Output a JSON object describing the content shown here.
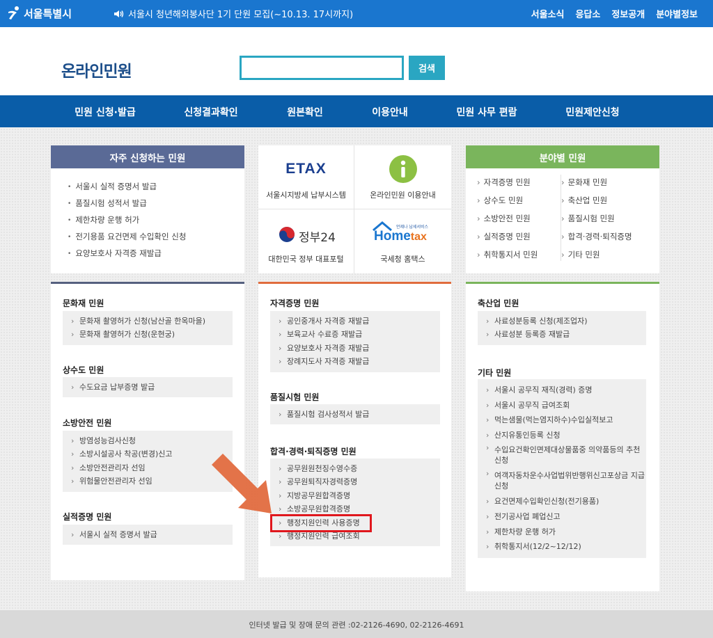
{
  "topbar": {
    "logo_text": "서울특별시",
    "notice": "서울시 청년해외봉사단 1기 단원 모집(~10.13. 17시까지)",
    "links": [
      "서울소식",
      "응답소",
      "정보공개",
      "분야별정보"
    ]
  },
  "header": {
    "title": "온라인민원",
    "search_value": "",
    "search_button": "검색"
  },
  "nav": [
    "민원 신청·발급",
    "신청결과확인",
    "원본확인",
    "이용안내",
    "민원 사무 편람",
    "민원제안신청"
  ],
  "frequent": {
    "title": "자주 신청하는 민원",
    "items": [
      "서울시 실적 증명서 발급",
      "품질시험 성적서 발급",
      "제한차량 운행 허가",
      "전기용품 요건면제 수입확인 신청",
      "요양보호사 자격증 재발급"
    ]
  },
  "quick_links": {
    "etax_logo": "ETAX",
    "etax_label": "서울시지방세 납부시스템",
    "info_label": "온라인민원 이용안내",
    "gov24_logo": "정부24",
    "gov24_label": "대한민국 정부 대표포털",
    "hometax_tagline": "언제나 납세서비스",
    "hometax_logo_a": "Home",
    "hometax_logo_b": "tax",
    "hometax_label": "국세청 홈택스"
  },
  "fields": {
    "title": "분야별 민원",
    "items": [
      "자격증명 민원",
      "문화재 민원",
      "상수도 민원",
      "축산업 민원",
      "소방안전 민원",
      "품질시험 민원",
      "실적증명 민원",
      "합격·경력·퇴직증명",
      "취학통지서 민원",
      "기타 민원"
    ]
  },
  "left_panel": {
    "sections": [
      {
        "title": "문화재 민원",
        "items": [
          "문화재 촬영허가 신청(남산골 한옥마을)",
          "문화재 촬영허가 신청(운현궁)"
        ]
      },
      {
        "title": "상수도 민원",
        "items": [
          "수도요금 납부증명 발급"
        ]
      },
      {
        "title": "소방안전 민원",
        "items": [
          "방염성능검사신청",
          "소방시설공사 착공(변경)신고",
          "소방안전관리자 선임",
          "위험물안전관리자 선임"
        ]
      },
      {
        "title": "실적증명 민원",
        "items": [
          "서울시 실적 증명서 발급"
        ]
      }
    ]
  },
  "center_panel": {
    "sections": [
      {
        "title": "자격증명 민원",
        "items": [
          "공인중개사 자격증 재발급",
          "보육교사 수료증 재발급",
          "요양보호사 자격증 재발급",
          "장례지도사 자격증 재발급"
        ]
      },
      {
        "title": "품질시험 민원",
        "items": [
          "품질시험 검사성적서 발급"
        ]
      },
      {
        "title": "합격·경력·퇴직증명 민원",
        "items": [
          "공무원원천징수영수증",
          "공무원퇴직자경력증명",
          "지방공무원합격증명",
          "소방공무원합격증명",
          "행정지원인력 사용증명",
          "행정지원인력 급여조회"
        ]
      }
    ]
  },
  "right_panel": {
    "sections": [
      {
        "title": "축산업 민원",
        "items": [
          "사료성분등록 신청(제조업자)",
          "사료성분 등록증 재발급"
        ]
      },
      {
        "title": "기타 민원",
        "items": [
          "서울시 공무직 재직(경력) 증명",
          "서울시 공무직 급여조회",
          "먹는샘물(먹는염지하수)수입실적보고",
          "산지유통인등록 신청",
          "수입요건확인면제대상물품중 의약품등의 추천신청",
          "여객자동차운수사업법위반행위신고포상금 지급신청",
          "요건면제수입확인신청(전기용품)",
          "전기공사업 폐업신고",
          "제한차량 운행 허가",
          "취학통지서(12/2~12/12)"
        ]
      }
    ]
  },
  "footer": {
    "text": "인터넷 발급 및 장애 문의 관련 :02-2126-4690, 02-2126-4691"
  },
  "colors": {
    "topbar": "#1a76cf",
    "nav": "#0a5da8",
    "search_accent": "#2aa6c2",
    "frequent_head": "#5a6a96",
    "fields_head": "#7ab55c",
    "left_panel_top": "#55607f",
    "center_panel_top": "#e06c3d",
    "right_panel_top": "#7ab55c",
    "highlight": "#e0171d",
    "arrow": "#e26b3f"
  }
}
